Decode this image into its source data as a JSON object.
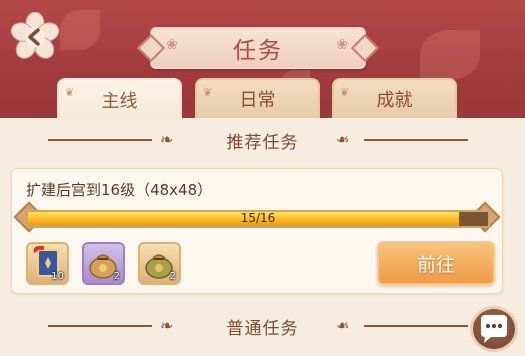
{
  "header": {
    "title": "任务"
  },
  "tabs": [
    {
      "label": "主线",
      "active": true
    },
    {
      "label": "日常",
      "active": false
    },
    {
      "label": "成就",
      "active": false
    }
  ],
  "sections": {
    "recommended": "推荐任务",
    "normal": "普通任务"
  },
  "task": {
    "title": "扩建后宫到16级（48x48）",
    "progress_text": "15/16",
    "progress_fraction": 0.9375,
    "rewards": [
      {
        "icon": "banner-scroll-icon",
        "count": "10",
        "frame": "gold"
      },
      {
        "icon": "money-bag-icon",
        "count": "2",
        "frame": "purple"
      },
      {
        "icon": "money-bag-icon",
        "count": "2",
        "frame": "gold"
      }
    ],
    "go_label": "前往"
  },
  "colors": {
    "header_red": "#a33c3e",
    "accent_orange": "#ef9b46",
    "progress_gold": "#f7b51e"
  }
}
